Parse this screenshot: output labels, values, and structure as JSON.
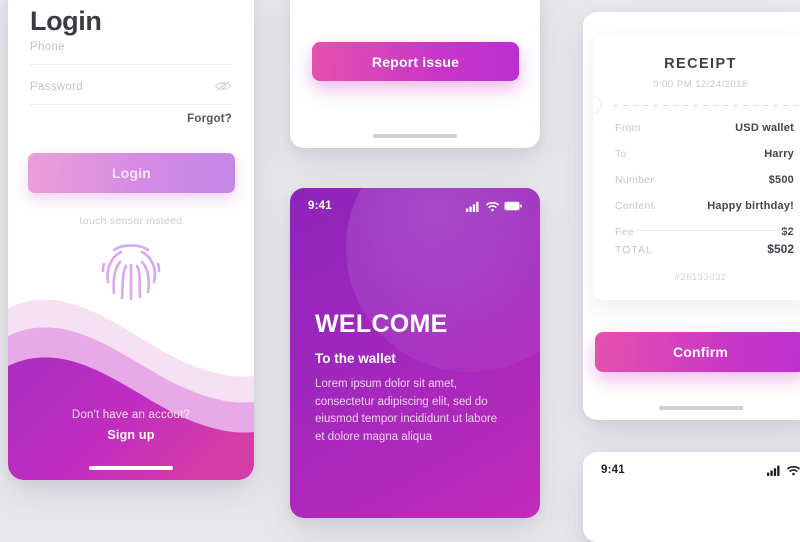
{
  "background_color": "#e9e9ec",
  "accent": {
    "pink": "#e452ad",
    "purple": "#bd30d2",
    "deep_purple": "#8e24bc",
    "magenta": "#c22bb8",
    "muted_pink": "#eb9fd8",
    "muted_purple": "#c587e8"
  },
  "login_screen": {
    "title": "Login",
    "phone_placeholder": "Phone",
    "password_placeholder": "Password",
    "password_toggle_icon": "eye-slash-icon",
    "forgot_label": "Forgot?",
    "login_button_label": "Login",
    "touch_hint": "touch sensor insteed",
    "fingerprint_icon": "fingerprint-icon",
    "signup_question": "Don't have  an accout?",
    "signup_label": "Sign up"
  },
  "report_screen": {
    "button_label": "Report issue"
  },
  "welcome_screen": {
    "status_time": "9:41",
    "status_icons": [
      "signal-icon",
      "wifi-icon",
      "battery-icon"
    ],
    "heading": "WELCOME",
    "subheading": "To the wallet",
    "body": "Lorem ipsum dolor sit amet, consectetur adipiscing elit, sed do eiusmod tempor incididunt ut labore et dolore magna aliqua"
  },
  "receipt_screen": {
    "title": "RECEIPT",
    "date": "9:00 PM 12/24/2018",
    "rows": [
      {
        "label": "From",
        "value": "USD wallet"
      },
      {
        "label": "To",
        "value": "Harry"
      },
      {
        "label": "Number",
        "value": "$500"
      },
      {
        "label": "Content",
        "value": "Happy  birthday!"
      },
      {
        "label": "Fee",
        "value": "$2"
      }
    ],
    "total_label": "TOTAL",
    "total_value": "$502",
    "reference": "#28193032",
    "confirm_button_label": "Confirm"
  },
  "bottom_screen": {
    "status_time": "9:41",
    "status_icons": [
      "signal-icon",
      "wifi-icon"
    ]
  }
}
